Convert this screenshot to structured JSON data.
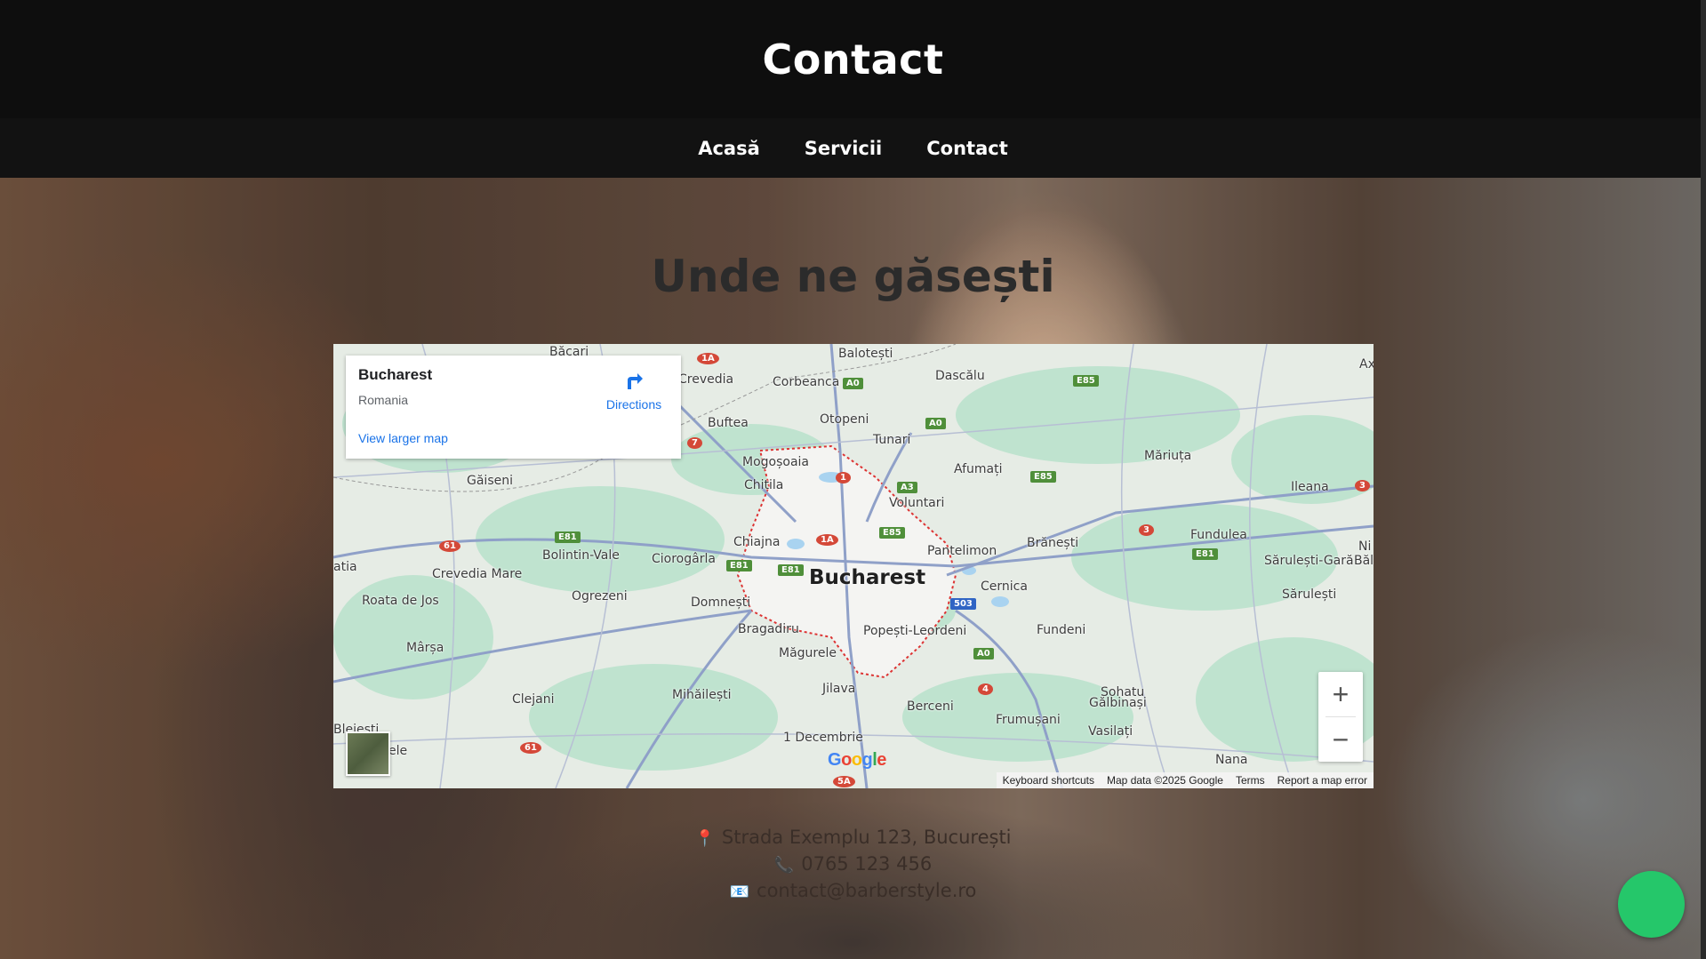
{
  "header": {
    "title": "Contact"
  },
  "nav": {
    "items": [
      "Acasă",
      "Servicii",
      "Contact"
    ]
  },
  "hero": {
    "heading": "Unde ne găsești"
  },
  "map": {
    "card": {
      "title": "Bucharest",
      "subtitle": "Romania",
      "directions": "Directions",
      "larger_map": "View larger map"
    },
    "places": {
      "bucharest": "Bucharest",
      "baloteşti": "Balotești",
      "dascalu": "Dascălu",
      "corbeanca": "Corbeanca",
      "crevedia": "Crevedia",
      "buftea": "Buftea",
      "otopeni": "Otopeni",
      "tunari": "Tunari",
      "mogosoaia": "Mogoșoaia",
      "chitila": "Chitila",
      "afumati": "Afumați",
      "voluntari": "Voluntari",
      "mariuta": "Măriuța",
      "ileana": "Ileana",
      "gaiseni": "Găiseni",
      "bolintin": "Bolintin-Vale",
      "ciorogarla": "Ciorogârla",
      "chiajna": "Chiajna",
      "pantelimon": "Pantelimon",
      "branesti": "Brănești",
      "fundulea": "Fundulea",
      "sarulesti_gara": "Sărulești-Gară",
      "bal": "Băl",
      "crevedia_mare": "Crevedia Mare",
      "roata": "Roata de Jos",
      "ogrezeni": "Ogrezeni",
      "domnesti": "Domnești",
      "cernica": "Cernica",
      "sarulesti": "Sărulești",
      "bragadiru": "Bragadiru",
      "popesti": "Popești-Leordeni",
      "fundeni": "Fundeni",
      "marsa": "Mârșa",
      "magurele": "Măgurele",
      "mihailesti": "Mihăilești",
      "clejani": "Clejani",
      "jilava": "Jilava",
      "sohatu": "Sohatu",
      "galbinasi": "Gălbinași",
      "berceni": "Berceni",
      "frumusani": "Frumușani",
      "vasilati": "Vasilați",
      "decembrie": "1 Decembrie",
      "nana": "Nana",
      "bacari": "Băcari",
      "atia": "atia",
      "ax": "Ax",
      "ni": "Ni",
      "bleje": "Blejești",
      "ele": "ele"
    },
    "google": "Google",
    "attribution": [
      "Keyboard shortcuts",
      "Map data ©2025 Google",
      "Terms",
      "Report a map error"
    ],
    "zoom_in": "+",
    "zoom_out": "−"
  },
  "contact": {
    "address": "Strada Exemplu 123, București",
    "phone": "0765 123 456",
    "email": "contact@barberstyle.ro",
    "icons": [
      "pin-icon",
      "phone-icon",
      "email-icon"
    ]
  },
  "colors": {
    "header_bg": "#0e0e0e",
    "nav_bg": "#121212",
    "map_water": "#a9d3f0",
    "map_green": "#bfe3cf",
    "chat_button": "#25c76a",
    "link_blue": "#1a73e8"
  }
}
